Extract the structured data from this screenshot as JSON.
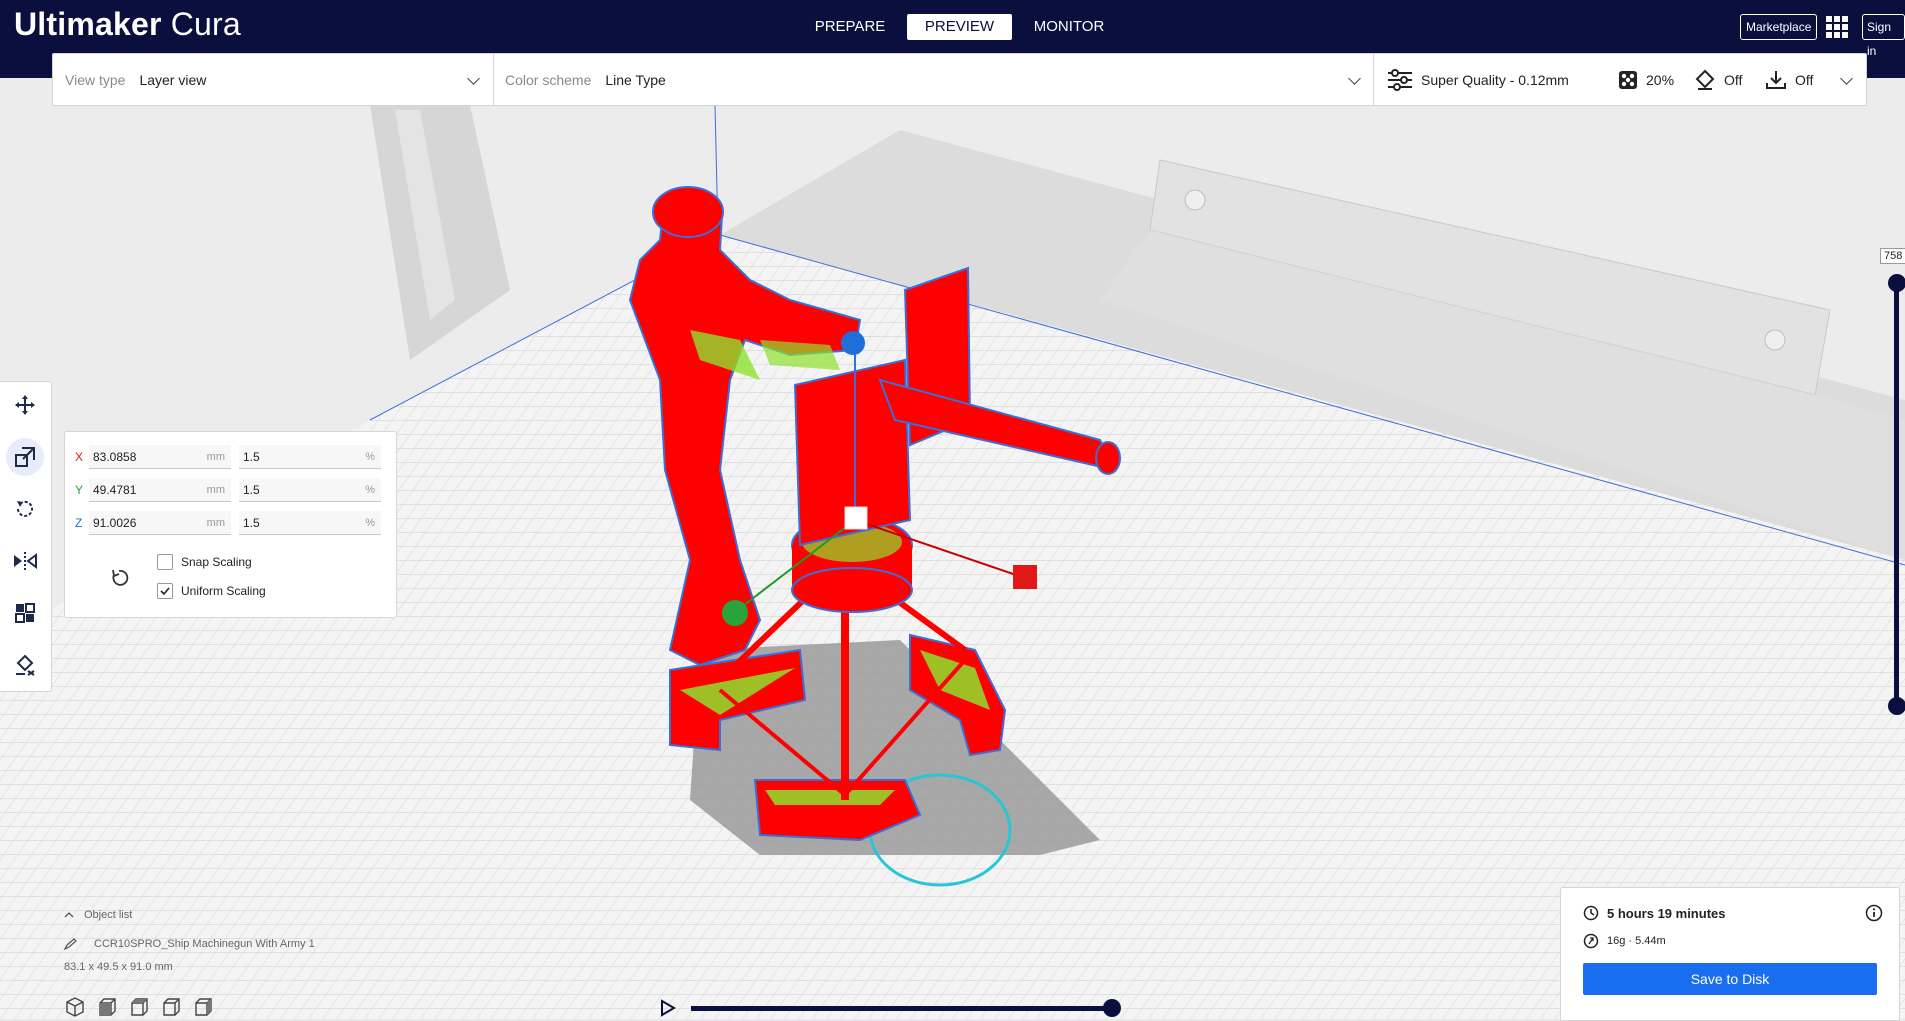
{
  "app": {
    "title_bold": "Ultimaker",
    "title_light": "Cura"
  },
  "stages": [
    {
      "label": "PREPARE",
      "active": false
    },
    {
      "label": "PREVIEW",
      "active": true
    },
    {
      "label": "MONITOR",
      "active": false
    }
  ],
  "header": {
    "marketplace_label": "Marketplace",
    "signin_label": "Sign in"
  },
  "settingsbar": {
    "view_type_label": "View type",
    "view_type_value": "Layer view",
    "color_scheme_label": "Color scheme",
    "color_scheme_value": "Line Type",
    "profile": "Super Quality - 0.12mm",
    "infill": "20%",
    "support": "Off",
    "adhesion": "Off"
  },
  "tools": [
    {
      "name": "move-tool",
      "icon": "move-icon",
      "active": false
    },
    {
      "name": "scale-tool",
      "icon": "scale-icon",
      "active": true
    },
    {
      "name": "rotate-tool",
      "icon": "rotate-icon",
      "active": false
    },
    {
      "name": "mirror-tool",
      "icon": "mirror-icon",
      "active": false
    },
    {
      "name": "per-model-settings-tool",
      "icon": "per-model-settings-icon",
      "active": false
    },
    {
      "name": "support-blocker-tool",
      "icon": "support-blocker-icon",
      "active": false
    }
  ],
  "scale_panel": {
    "x": {
      "axis": "X",
      "mm": "83.0858",
      "unit_mm": "mm",
      "pct": "1.5",
      "unit_pct": "%"
    },
    "y": {
      "axis": "Y",
      "mm": "49.4781",
      "unit_mm": "mm",
      "pct": "1.5",
      "unit_pct": "%"
    },
    "z": {
      "axis": "Z",
      "mm": "91.0026",
      "unit_mm": "mm",
      "pct": "1.5",
      "unit_pct": "%"
    },
    "snap_scaling_label": "Snap Scaling",
    "snap_scaling_checked": false,
    "uniform_scaling_label": "Uniform Scaling",
    "uniform_scaling_checked": true
  },
  "object_list": {
    "toggle_label": "Object list",
    "object_name": "CCR10SPRO_Ship Machinegun With Army 1",
    "dimensions": "83.1 x 49.5 x 91.0 mm"
  },
  "layer_slider": {
    "current_layer": "758"
  },
  "print_info": {
    "time": "5 hours 19 minutes",
    "material": "16g · 5.44m",
    "save_label": "Save to Disk"
  },
  "colors": {
    "header_bg": "#0a0f3d",
    "accent_blue": "#196ef0",
    "model_red": "#ff0000",
    "outline_blue": "#3b6fd8",
    "infill_green": "#8ee12d",
    "travel_cyan": "#27c6d6"
  }
}
